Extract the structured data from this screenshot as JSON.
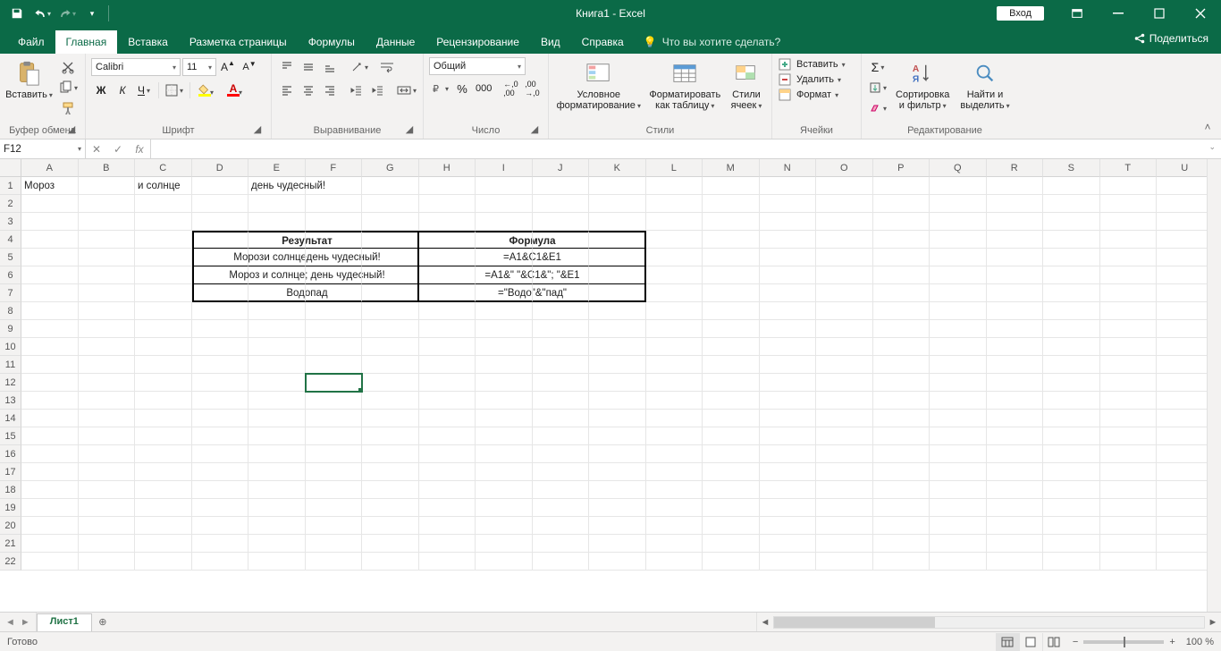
{
  "title": "Книга1  -  Excel",
  "login": "Вход",
  "tabs": [
    "Файл",
    "Главная",
    "Вставка",
    "Разметка страницы",
    "Формулы",
    "Данные",
    "Рецензирование",
    "Вид",
    "Справка"
  ],
  "active_tab": 1,
  "tellme": "Что вы хотите сделать?",
  "share": "Поделиться",
  "groups": {
    "clipboard": "Буфер обмена",
    "paste": "Вставить",
    "font": "Шрифт",
    "font_name": "Calibri",
    "font_size": "11",
    "alignment": "Выравнивание",
    "number": "Число",
    "numfmt": "Общий",
    "styles": "Стили",
    "cond_fmt": "Условное\nформатирование",
    "fmt_table": "Форматировать\nкак таблицу",
    "cell_styles": "Стили\nячеек",
    "cells": "Ячейки",
    "insert": "Вставить",
    "delete": "Удалить",
    "format": "Формат",
    "editing": "Редактирование",
    "sort_filter": "Сортировка\nи фильтр",
    "find_select": "Найти и\nвыделить"
  },
  "namebox": "F12",
  "columns": [
    "A",
    "B",
    "C",
    "D",
    "E",
    "F",
    "G",
    "H",
    "I",
    "J",
    "K",
    "L",
    "M",
    "N",
    "O",
    "P",
    "Q",
    "R",
    "S",
    "T",
    "U"
  ],
  "rows": 22,
  "selected": {
    "col": 5,
    "row": 12
  },
  "cells": {
    "A1": "Мороз",
    "C1": "и солнце",
    "E1": "день чудесный!",
    "D4": "Результат",
    "I4": "Формула",
    "D5": "Морози солнцедень чудесный!",
    "I5": "=A1&C1&E1",
    "D6": "Мороз и солнце; день чудесный!",
    "I6": "=A1&\" \"&C1&\"; \"&E1",
    "D7": "Водопад",
    "I7": "=\"Водо\"&\"пад\""
  },
  "sheet_tab": "Лист1",
  "status": "Готово",
  "zoom": "100 %"
}
